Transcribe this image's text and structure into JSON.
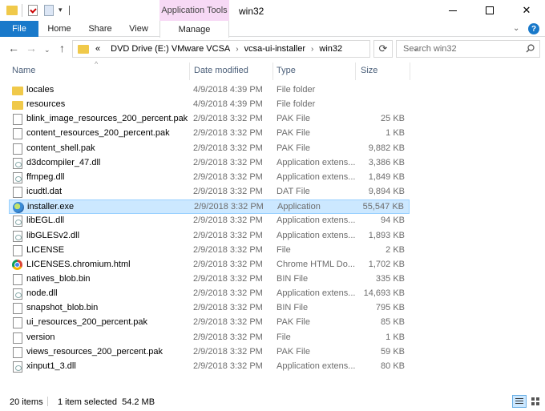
{
  "window": {
    "title": "win32",
    "contextual_tab": "Application Tools"
  },
  "ribbon": {
    "tabs": [
      "File",
      "Home",
      "Share",
      "View",
      "Manage"
    ],
    "help": "?"
  },
  "address": {
    "overflow": "«",
    "crumbs": [
      "DVD Drive (E:) VMware VCSA",
      "vcsa-ui-installer",
      "win32"
    ]
  },
  "search": {
    "placeholder": "Search win32"
  },
  "columns": {
    "name": "Name",
    "date": "Date modified",
    "type": "Type",
    "size": "Size"
  },
  "files": [
    {
      "name": "locales",
      "date": "4/9/2018 4:39 PM",
      "type": "File folder",
      "size": "",
      "icon": "folder-icon"
    },
    {
      "name": "resources",
      "date": "4/9/2018 4:39 PM",
      "type": "File folder",
      "size": "",
      "icon": "folder-icon"
    },
    {
      "name": "blink_image_resources_200_percent.pak",
      "date": "2/9/2018 3:32 PM",
      "type": "PAK File",
      "size": "25 KB",
      "icon": "file-icon"
    },
    {
      "name": "content_resources_200_percent.pak",
      "date": "2/9/2018 3:32 PM",
      "type": "PAK File",
      "size": "1 KB",
      "icon": "file-icon"
    },
    {
      "name": "content_shell.pak",
      "date": "2/9/2018 3:32 PM",
      "type": "PAK File",
      "size": "9,882 KB",
      "icon": "file-icon"
    },
    {
      "name": "d3dcompiler_47.dll",
      "date": "2/9/2018 3:32 PM",
      "type": "Application extens...",
      "size": "3,386 KB",
      "icon": "dll-icon"
    },
    {
      "name": "ffmpeg.dll",
      "date": "2/9/2018 3:32 PM",
      "type": "Application extens...",
      "size": "1,849 KB",
      "icon": "dll-icon"
    },
    {
      "name": "icudtl.dat",
      "date": "2/9/2018 3:32 PM",
      "type": "DAT File",
      "size": "9,894 KB",
      "icon": "file-icon"
    },
    {
      "name": "installer.exe",
      "date": "2/9/2018 3:32 PM",
      "type": "Application",
      "size": "55,547 KB",
      "icon": "installer-icon",
      "selected": true
    },
    {
      "name": "libEGL.dll",
      "date": "2/9/2018 3:32 PM",
      "type": "Application extens...",
      "size": "94 KB",
      "icon": "dll-icon"
    },
    {
      "name": "libGLESv2.dll",
      "date": "2/9/2018 3:32 PM",
      "type": "Application extens...",
      "size": "1,893 KB",
      "icon": "dll-icon"
    },
    {
      "name": "LICENSE",
      "date": "2/9/2018 3:32 PM",
      "type": "File",
      "size": "2 KB",
      "icon": "file-icon"
    },
    {
      "name": "LICENSES.chromium.html",
      "date": "2/9/2018 3:32 PM",
      "type": "Chrome HTML Do...",
      "size": "1,702 KB",
      "icon": "chrome-icon"
    },
    {
      "name": "natives_blob.bin",
      "date": "2/9/2018 3:32 PM",
      "type": "BIN File",
      "size": "335 KB",
      "icon": "file-icon"
    },
    {
      "name": "node.dll",
      "date": "2/9/2018 3:32 PM",
      "type": "Application extens...",
      "size": "14,693 KB",
      "icon": "dll-icon"
    },
    {
      "name": "snapshot_blob.bin",
      "date": "2/9/2018 3:32 PM",
      "type": "BIN File",
      "size": "795 KB",
      "icon": "file-icon"
    },
    {
      "name": "ui_resources_200_percent.pak",
      "date": "2/9/2018 3:32 PM",
      "type": "PAK File",
      "size": "85 KB",
      "icon": "file-icon"
    },
    {
      "name": "version",
      "date": "2/9/2018 3:32 PM",
      "type": "File",
      "size": "1 KB",
      "icon": "file-icon"
    },
    {
      "name": "views_resources_200_percent.pak",
      "date": "2/9/2018 3:32 PM",
      "type": "PAK File",
      "size": "59 KB",
      "icon": "file-icon"
    },
    {
      "name": "xinput1_3.dll",
      "date": "2/9/2018 3:32 PM",
      "type": "Application extens...",
      "size": "80 KB",
      "icon": "dll-icon"
    }
  ],
  "status": {
    "count": "20 items",
    "selection": "1 item selected  54.2 MB"
  },
  "colors": {
    "accent": "#1979ca",
    "selection_bg": "#cce8ff",
    "selection_border": "#99d1ff",
    "context_tab": "#f7d9f5",
    "folder": "#f0c94a"
  }
}
